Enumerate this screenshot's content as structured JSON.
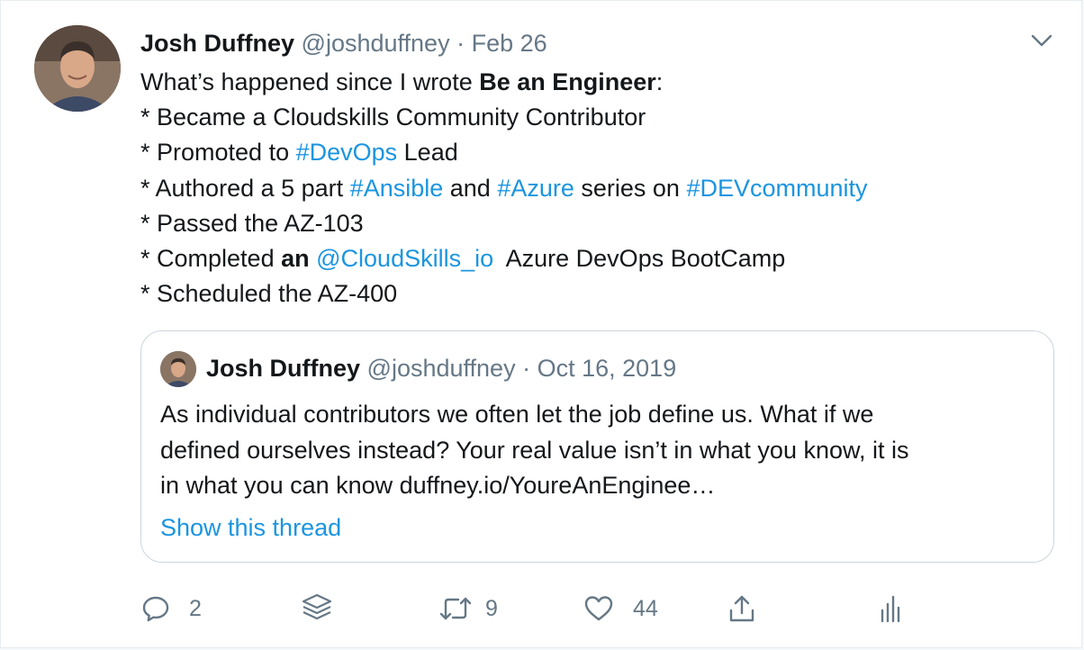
{
  "tweet": {
    "author": {
      "name": "Josh Duffney",
      "handle": "@joshduffney"
    },
    "separator": "·",
    "date": "Feb 26",
    "body": {
      "l1": {
        "a": "What’s happened since I wrote ",
        "bold": "Be an Engineer",
        "b": ":"
      },
      "l2": "* Became a Cloudskills Community Contributor",
      "l3": {
        "a": "* Promoted to ",
        "tag": "#DevOps",
        "b": " Lead"
      },
      "l4": {
        "a": "* Authored a 5 part ",
        "tag1": "#Ansible",
        "b": " and ",
        "tag2": "#Azure",
        "c": " series on ",
        "tag3": "#DEVcommunity"
      },
      "l5": "* Passed the AZ-103",
      "l6": {
        "a": "* Completed ",
        "bold": "an",
        "mention": "@CloudSkills_io",
        "b": "  Azure DevOps BootCamp"
      },
      "l7": "* Scheduled the AZ-400"
    }
  },
  "quote": {
    "author": {
      "name": "Josh Duffney",
      "handle": "@joshduffney"
    },
    "separator": "·",
    "date": "Oct 16, 2019",
    "lines": [
      "As individual contributors we often let the job define us. What if we",
      "defined ourselves instead? Your real value isn’t in what you know, it is",
      "in what you can know duffney.io/YoureAnEnginee…"
    ],
    "show_thread": "Show this thread"
  },
  "actions": {
    "reply_count": "2",
    "retweet_count": "9",
    "like_count": "44"
  },
  "colors": {
    "link": "#1b95e0",
    "muted": "#657786",
    "text": "#14171a",
    "border": "#ccd6dd"
  }
}
